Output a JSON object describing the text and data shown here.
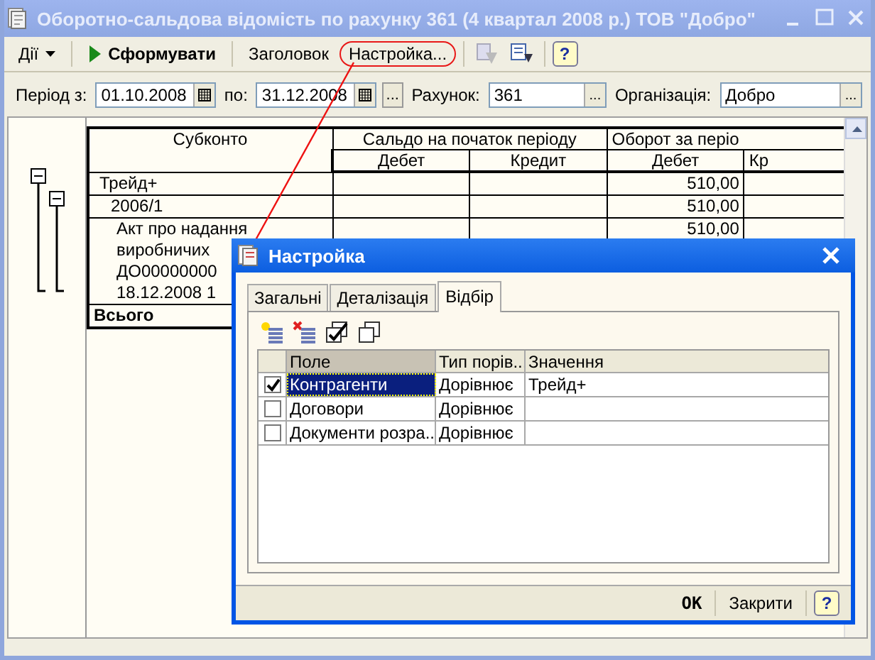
{
  "window": {
    "title": "Оборотно-сальдова відомість по рахунку 361 (4 квартал 2008 р.) ТОВ \"Добро\""
  },
  "toolbar": [
    {
      "kind": "menu",
      "label": "Дії"
    },
    {
      "kind": "run",
      "label": "Сформувати"
    },
    {
      "kind": "text",
      "label": "Заголовок"
    },
    {
      "kind": "text",
      "label": "Настройка...",
      "circled": true
    },
    {
      "kind": "help",
      "label": "?"
    }
  ],
  "form": {
    "period_from_label": "Період з:",
    "period_from": "01.10.2008",
    "period_to_label": "по:",
    "period_to": "31.12.2008",
    "period_button": "...",
    "account_button": "...",
    "organization_button": "...",
    "account_label": "Рахунок:",
    "account": "361",
    "organization_label": "Організація:",
    "organization": "Добро"
  },
  "report": {
    "header_top": [
      "Субконто",
      "Сальдо на початок періоду",
      "Оборот за періо"
    ],
    "header_sub": [
      "Дебет",
      "Кредит",
      "Дебет",
      "Кр"
    ],
    "rows": [
      {
        "kind": "level1",
        "lines": [
          "Трейд+"
        ],
        "cells": [
          "",
          "",
          "510,00",
          ""
        ]
      },
      {
        "kind": "level2",
        "lines": [
          "2006/1"
        ],
        "cells": [
          "",
          "",
          "510,00",
          ""
        ]
      },
      {
        "kind": "level3",
        "lines": [
          "Акт про надання",
          "виробничих",
          "ДО00000000",
          "18.12.2008 1"
        ],
        "cells": [
          "",
          "",
          "510,00",
          ""
        ]
      },
      {
        "kind": "total",
        "lines": [
          "Всього"
        ],
        "cells": [
          "",
          "",
          "",
          ""
        ]
      }
    ]
  },
  "dialog": {
    "title": "Настройка",
    "tabs": [
      {
        "label": "Загальні",
        "selected": false
      },
      {
        "label": "Деталізація",
        "selected": false
      },
      {
        "label": "Відбір",
        "selected": true
      }
    ],
    "columns": [
      "Поле",
      "Тип порів...",
      "Значення"
    ],
    "rows": [
      {
        "checked": true,
        "selected": true,
        "field": "Контрагенти",
        "comparison": "Дорівнює",
        "value": "Трейд+"
      },
      {
        "checked": false,
        "selected": false,
        "field": "Договори",
        "comparison": "Дорівнює",
        "value": ""
      },
      {
        "checked": false,
        "selected": false,
        "field": "Документи розра...",
        "comparison": "Дорівнює",
        "value": ""
      }
    ],
    "buttons": [
      {
        "kind": "ok",
        "label": "OK"
      },
      {
        "kind": "close",
        "label": "Закрити"
      },
      {
        "kind": "help",
        "label": "?"
      }
    ]
  }
}
